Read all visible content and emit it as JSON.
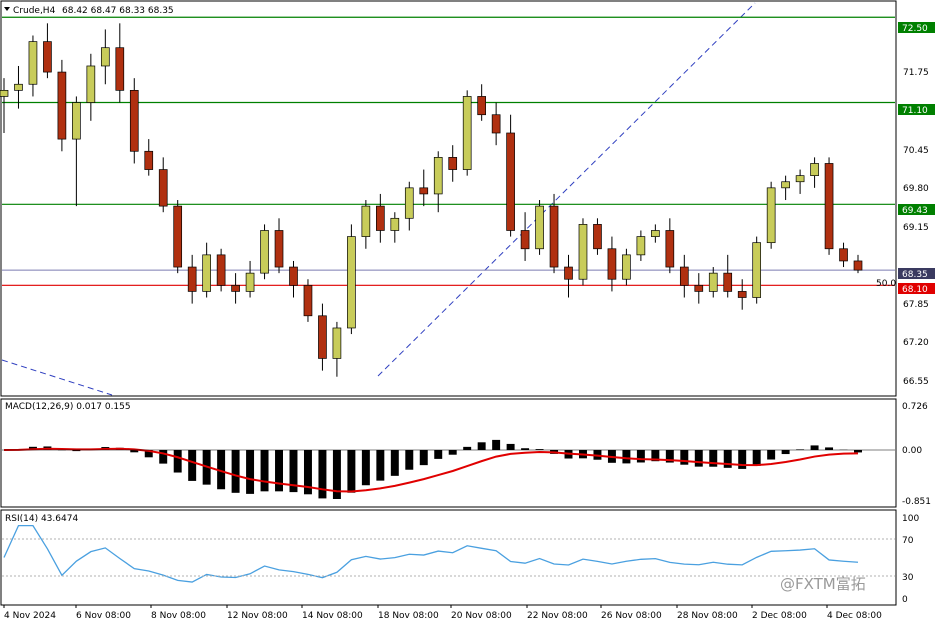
{
  "header": {
    "symbol_label": "Crude,H4",
    "ohlc": "68.42 68.47 68.33 68.35",
    "dropdown_icon": "triangle-down-icon"
  },
  "price_axis": {
    "ticks": [
      "72.50",
      "71.75",
      "71.10",
      "70.45",
      "69.80",
      "69.15",
      "68.50",
      "67.85",
      "67.20",
      "66.55"
    ],
    "current_price": "68.35",
    "level_labels": [
      "72.50",
      "71.10",
      "69.43",
      "68.10"
    ],
    "fib_label": "50.0"
  },
  "levels": [
    {
      "price": 72.5,
      "color": "#008000",
      "label": "72.50"
    },
    {
      "price": 71.1,
      "color": "#008000",
      "label": "71.10"
    },
    {
      "price": 69.43,
      "color": "#008000",
      "label": "69.43"
    },
    {
      "price": 68.1,
      "color": "#e00000",
      "label": "68.10"
    }
  ],
  "current_price_line": {
    "price": 68.35,
    "color": "#7b7bb0"
  },
  "macd": {
    "label": "MACD(12,26,9) 0.017 0.155",
    "axis": [
      "0.726",
      "0.00",
      "-0.851"
    ]
  },
  "rsi": {
    "label": "RSI(14) 43.6474",
    "axis": [
      "100",
      "70",
      "30",
      "0"
    ]
  },
  "time_axis": [
    "4 Nov 2024",
    "6 Nov 08:00",
    "8 Nov 08:00",
    "12 Nov 08:00",
    "14 Nov 08:00",
    "18 Nov 08:00",
    "20 Nov 08:00",
    "22 Nov 08:00",
    "26 Nov 08:00",
    "28 Nov 08:00",
    "2 Dec 08:00",
    "4 Dec 08:00"
  ],
  "watermark": "@FXTM富拓",
  "colors": {
    "bull": "#c8cc5a",
    "bear": "#b03010",
    "signal": "#e00000",
    "rsi": "#4aa0e0",
    "trend": "#3040c0"
  },
  "chart_data": {
    "type": "candlestick",
    "ohlc_sample": [
      [
        71.2,
        71.5,
        70.6,
        71.3
      ],
      [
        71.3,
        71.7,
        71.0,
        71.4
      ],
      [
        71.4,
        72.2,
        71.2,
        72.1
      ],
      [
        72.1,
        72.4,
        71.5,
        71.6
      ],
      [
        71.6,
        71.8,
        70.3,
        70.5
      ],
      [
        70.5,
        71.2,
        69.4,
        71.1
      ],
      [
        71.1,
        71.9,
        70.8,
        71.7
      ],
      [
        71.7,
        72.3,
        71.4,
        72.0
      ],
      [
        72.0,
        72.4,
        71.1,
        71.3
      ],
      [
        71.3,
        71.5,
        70.1,
        70.3
      ],
      [
        70.3,
        70.5,
        69.9,
        70.0
      ],
      [
        70.0,
        70.2,
        69.3,
        69.4
      ],
      [
        69.4,
        69.5,
        68.3,
        68.4
      ],
      [
        68.4,
        68.6,
        67.8,
        68.0
      ],
      [
        68.0,
        68.8,
        67.9,
        68.6
      ],
      [
        68.6,
        68.7,
        68.0,
        68.1
      ],
      [
        68.1,
        68.3,
        67.8,
        68.0
      ],
      [
        68.0,
        68.5,
        67.9,
        68.3
      ],
      [
        68.3,
        69.1,
        68.2,
        69.0
      ],
      [
        69.0,
        69.2,
        68.3,
        68.4
      ],
      [
        68.4,
        68.5,
        67.9,
        68.1
      ],
      [
        68.1,
        68.2,
        67.5,
        67.6
      ],
      [
        67.6,
        67.8,
        66.7,
        66.9
      ],
      [
        66.9,
        67.5,
        66.6,
        67.4
      ],
      [
        67.4,
        69.1,
        67.3,
        68.9
      ],
      [
        68.9,
        69.5,
        68.7,
        69.4
      ],
      [
        69.4,
        69.6,
        68.8,
        69.0
      ],
      [
        69.0,
        69.3,
        68.8,
        69.2
      ],
      [
        69.2,
        69.8,
        69.0,
        69.7
      ],
      [
        69.7,
        70.0,
        69.4,
        69.6
      ],
      [
        69.6,
        70.3,
        69.3,
        70.2
      ],
      [
        70.2,
        70.4,
        69.8,
        70.0
      ],
      [
        70.0,
        71.3,
        69.9,
        71.2
      ],
      [
        71.2,
        71.4,
        70.8,
        70.9
      ],
      [
        70.9,
        71.1,
        70.4,
        70.6
      ],
      [
        70.6,
        70.9,
        68.9,
        69.0
      ],
      [
        69.0,
        69.3,
        68.5,
        68.7
      ],
      [
        68.7,
        69.5,
        68.6,
        69.4
      ],
      [
        69.4,
        69.6,
        68.3,
        68.4
      ],
      [
        68.4,
        68.6,
        67.9,
        68.2
      ],
      [
        68.2,
        69.2,
        68.1,
        69.1
      ],
      [
        69.1,
        69.2,
        68.6,
        68.7
      ],
      [
        68.7,
        68.9,
        68.0,
        68.2
      ],
      [
        68.2,
        68.7,
        68.1,
        68.6
      ],
      [
        68.6,
        69.0,
        68.5,
        68.9
      ],
      [
        68.9,
        69.1,
        68.8,
        69.0
      ],
      [
        69.0,
        69.2,
        68.3,
        68.4
      ],
      [
        68.4,
        68.6,
        67.9,
        68.1
      ],
      [
        68.1,
        68.3,
        67.8,
        68.0
      ],
      [
        68.0,
        68.4,
        67.9,
        68.3
      ],
      [
        68.3,
        68.6,
        67.9,
        68.0
      ],
      [
        68.0,
        68.2,
        67.7,
        67.9
      ],
      [
        67.9,
        68.9,
        67.8,
        68.8
      ],
      [
        68.8,
        69.8,
        68.7,
        69.7
      ],
      [
        69.7,
        69.9,
        69.5,
        69.8
      ],
      [
        69.8,
        70.0,
        69.6,
        69.9
      ],
      [
        69.9,
        70.2,
        69.7,
        70.1
      ],
      [
        70.1,
        70.2,
        68.6,
        68.7
      ],
      [
        68.7,
        68.8,
        68.4,
        68.5
      ],
      [
        68.5,
        68.6,
        68.3,
        68.35
      ]
    ],
    "price_range": [
      66.3,
      72.75
    ],
    "macd_range": [
      -0.851,
      0.726
    ],
    "rsi_range": [
      0,
      100
    ]
  }
}
